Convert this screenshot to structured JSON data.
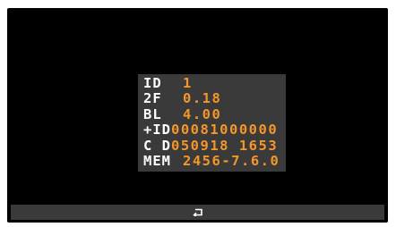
{
  "info": {
    "rows": [
      {
        "label": "ID",
        "value": "1"
      },
      {
        "label": "2F",
        "value": "0.18"
      },
      {
        "label": "BL",
        "value": "4.00"
      },
      {
        "label": "+ID",
        "value": "00081000000"
      },
      {
        "label": "C D",
        "value": "050918 1653"
      },
      {
        "label": "MEM",
        "value": "2456-7.6.0"
      }
    ]
  },
  "bottom_bar": {
    "back_icon": "return-arrow-icon"
  },
  "colors": {
    "background": "#000000",
    "panel": "#3a3a3a",
    "label": "#ffffff",
    "value": "#f5962a"
  }
}
